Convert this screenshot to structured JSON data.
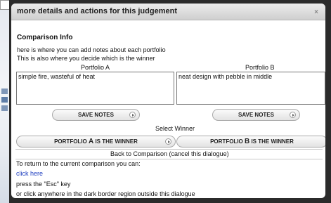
{
  "dialog": {
    "title": "more details and actions for this judgement",
    "close_label": "×"
  },
  "comparison": {
    "heading": "Comparison Info",
    "intro_line1": "here is where you can add notes about each portfolio",
    "intro_line2": "This is also where you decide which is the winner",
    "portfolio_a_label": "Portfolio A",
    "portfolio_b_label": "Portfolio B",
    "notes_a": "simple fire, wasteful of heat",
    "notes_b": "neat design with pebble in middle",
    "save_notes_label": "SAVE NOTES",
    "select_winner_label": "Select Winner",
    "winner_a": {
      "prefix": "PORTFOLIO ",
      "letter": "A",
      "suffix": " IS THE WINNER"
    },
    "winner_b": {
      "prefix": "PORTFOLIO ",
      "letter": "B",
      "suffix": " IS THE WINNER"
    },
    "back_label": "Back to Comparison (cancel this dialogue)"
  },
  "help": {
    "return_text": "To return to the current comparison you can:",
    "click_here": "click here",
    "esc_text": "press the \"Esc\" key",
    "outside_text": "or click anywhere in the dark border region outside this dialogue"
  }
}
